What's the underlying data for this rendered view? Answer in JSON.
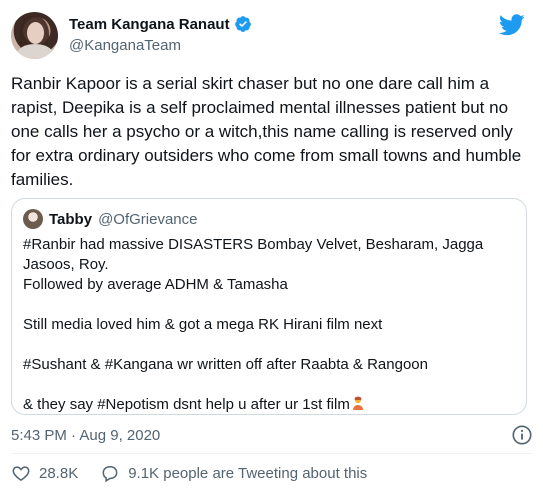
{
  "author": {
    "display_name": "Team Kangana Ranaut",
    "handle": "@KanganaTeam",
    "verified_icon": "verified-badge-icon",
    "avatar": "profile-photo"
  },
  "tweet": {
    "text": "Ranbir Kapoor is a serial skirt chaser but no one dare call him a rapist, Deepika is a self proclaimed mental illnesses patient but no one calls her a psycho or a witch,this name calling is reserved only for extra ordinary outsiders who come from small towns and humble families.",
    "timestamp": "5:43 PM · Aug 9, 2020"
  },
  "quote": {
    "name": "Tabby",
    "handle": "@OfGrievance",
    "lines": [
      "#Ranbir had massive DISASTERS Bombay Velvet, Besharam, Jagga Jasoos, Roy.",
      "Followed by average ADHM & Tamasha",
      "",
      "Still media loved him & got a mega RK Hirani film next",
      "",
      "#Sushant & #Kangana wr written off after Raabta & Rangoon",
      "",
      "& they say #Nepotism dsnt help u after ur 1st film"
    ],
    "emoji_icon": "person-gesturing-emoji"
  },
  "actions": {
    "like_count": "28.8K",
    "comment_text": "9.1K people are Tweeting about this"
  },
  "colors": {
    "text": "#0f1419",
    "secondary": "#536471",
    "accent": "#1d9bf0",
    "like": "#536471",
    "border": "#cfd9de"
  }
}
